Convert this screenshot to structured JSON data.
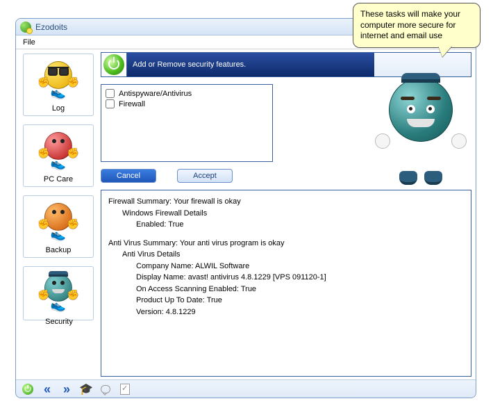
{
  "window": {
    "title": "Ezodoits"
  },
  "menu": {
    "file": "File"
  },
  "sidebar": {
    "items": [
      {
        "label": "Log"
      },
      {
        "label": "PC Care"
      },
      {
        "label": "Backup"
      },
      {
        "label": "Security"
      }
    ]
  },
  "banner": {
    "text": "Add or Remove security features."
  },
  "checklist": {
    "items": [
      {
        "label": "Antispyware/Antivirus",
        "checked": false
      },
      {
        "label": "Firewall",
        "checked": false
      }
    ]
  },
  "buttons": {
    "cancel": "Cancel",
    "accept": "Accept"
  },
  "summary": {
    "firewall_line": "Firewall Summary: Your firewall is okay",
    "firewall_details_header": "Windows Firewall Details",
    "firewall_enabled": "Enabled: True",
    "av_line": "Anti Virus Summary: Your anti virus program is okay",
    "av_details_header": "Anti Virus Details",
    "av_company": "Company Name: ALWIL Software",
    "av_display": "Display Name: avast! antivirus 4.8.1229 [VPS 091120-1]",
    "av_scan": "On Access Scanning Enabled: True",
    "av_uptodate": "Product Up To Date: True",
    "av_version": "Version: 4.8.1229"
  },
  "speech": {
    "text": "These tasks will make your computer more secure for internet and email use"
  }
}
